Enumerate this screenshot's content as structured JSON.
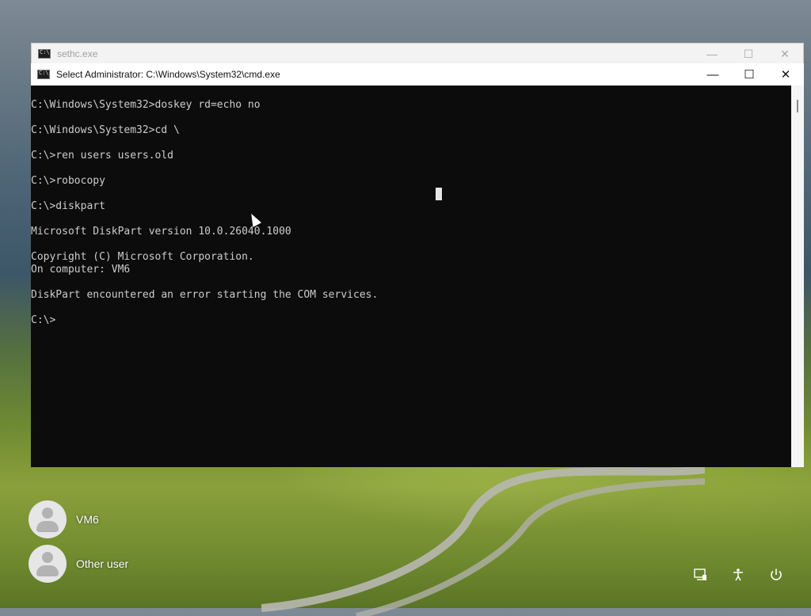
{
  "background_window": {
    "title": "sethc.exe",
    "controls": {
      "minimize": "—",
      "maximize": "☐",
      "close": "✕"
    }
  },
  "cmd_window": {
    "title": "Select Administrator: C:\\Windows\\System32\\cmd.exe",
    "controls": {
      "minimize": "—",
      "maximize": "☐",
      "close": "✕"
    },
    "console_lines": [
      "",
      "C:\\Windows\\System32>doskey rd=echo no",
      "",
      "C:\\Windows\\System32>cd \\",
      "",
      "C:\\>ren users users.old",
      "",
      "C:\\>robocopy",
      "",
      "C:\\>diskpart",
      "",
      "Microsoft DiskPart version 10.0.26040.1000",
      "",
      "Copyright (C) Microsoft Corporation.",
      "On computer: VM6",
      "",
      "DiskPart encountered an error starting the COM services.",
      "",
      "C:\\>"
    ]
  },
  "login": {
    "users": [
      {
        "name": "VM6"
      },
      {
        "name": "Other user"
      }
    ]
  },
  "system_icons": {
    "network": "network-icon",
    "accessibility": "accessibility-icon",
    "power": "power-icon"
  }
}
